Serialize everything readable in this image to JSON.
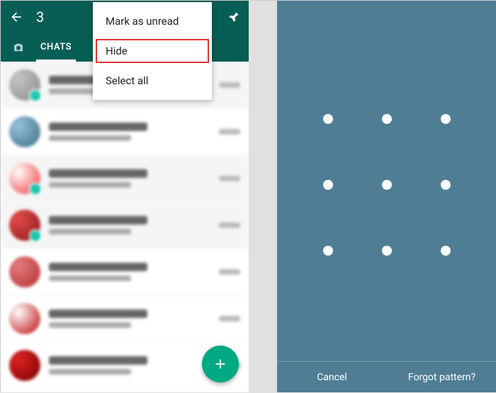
{
  "topbar": {
    "selected_count": "3"
  },
  "tabs": {
    "chats": "CHATS"
  },
  "menu": {
    "mark_unread": "Mark as unread",
    "hide": "Hide",
    "select_all": "Select all"
  },
  "lock": {
    "cancel": "Cancel",
    "forgot": "Forgot pattern?"
  },
  "chats": [
    {
      "selected": true
    },
    {
      "selected": false
    },
    {
      "selected": true
    },
    {
      "selected": true
    },
    {
      "selected": false
    },
    {
      "selected": false
    },
    {
      "selected": false
    }
  ],
  "colors": {
    "primary": "#075e54",
    "accent": "#00a884",
    "lock_bg": "#4f7d94"
  }
}
